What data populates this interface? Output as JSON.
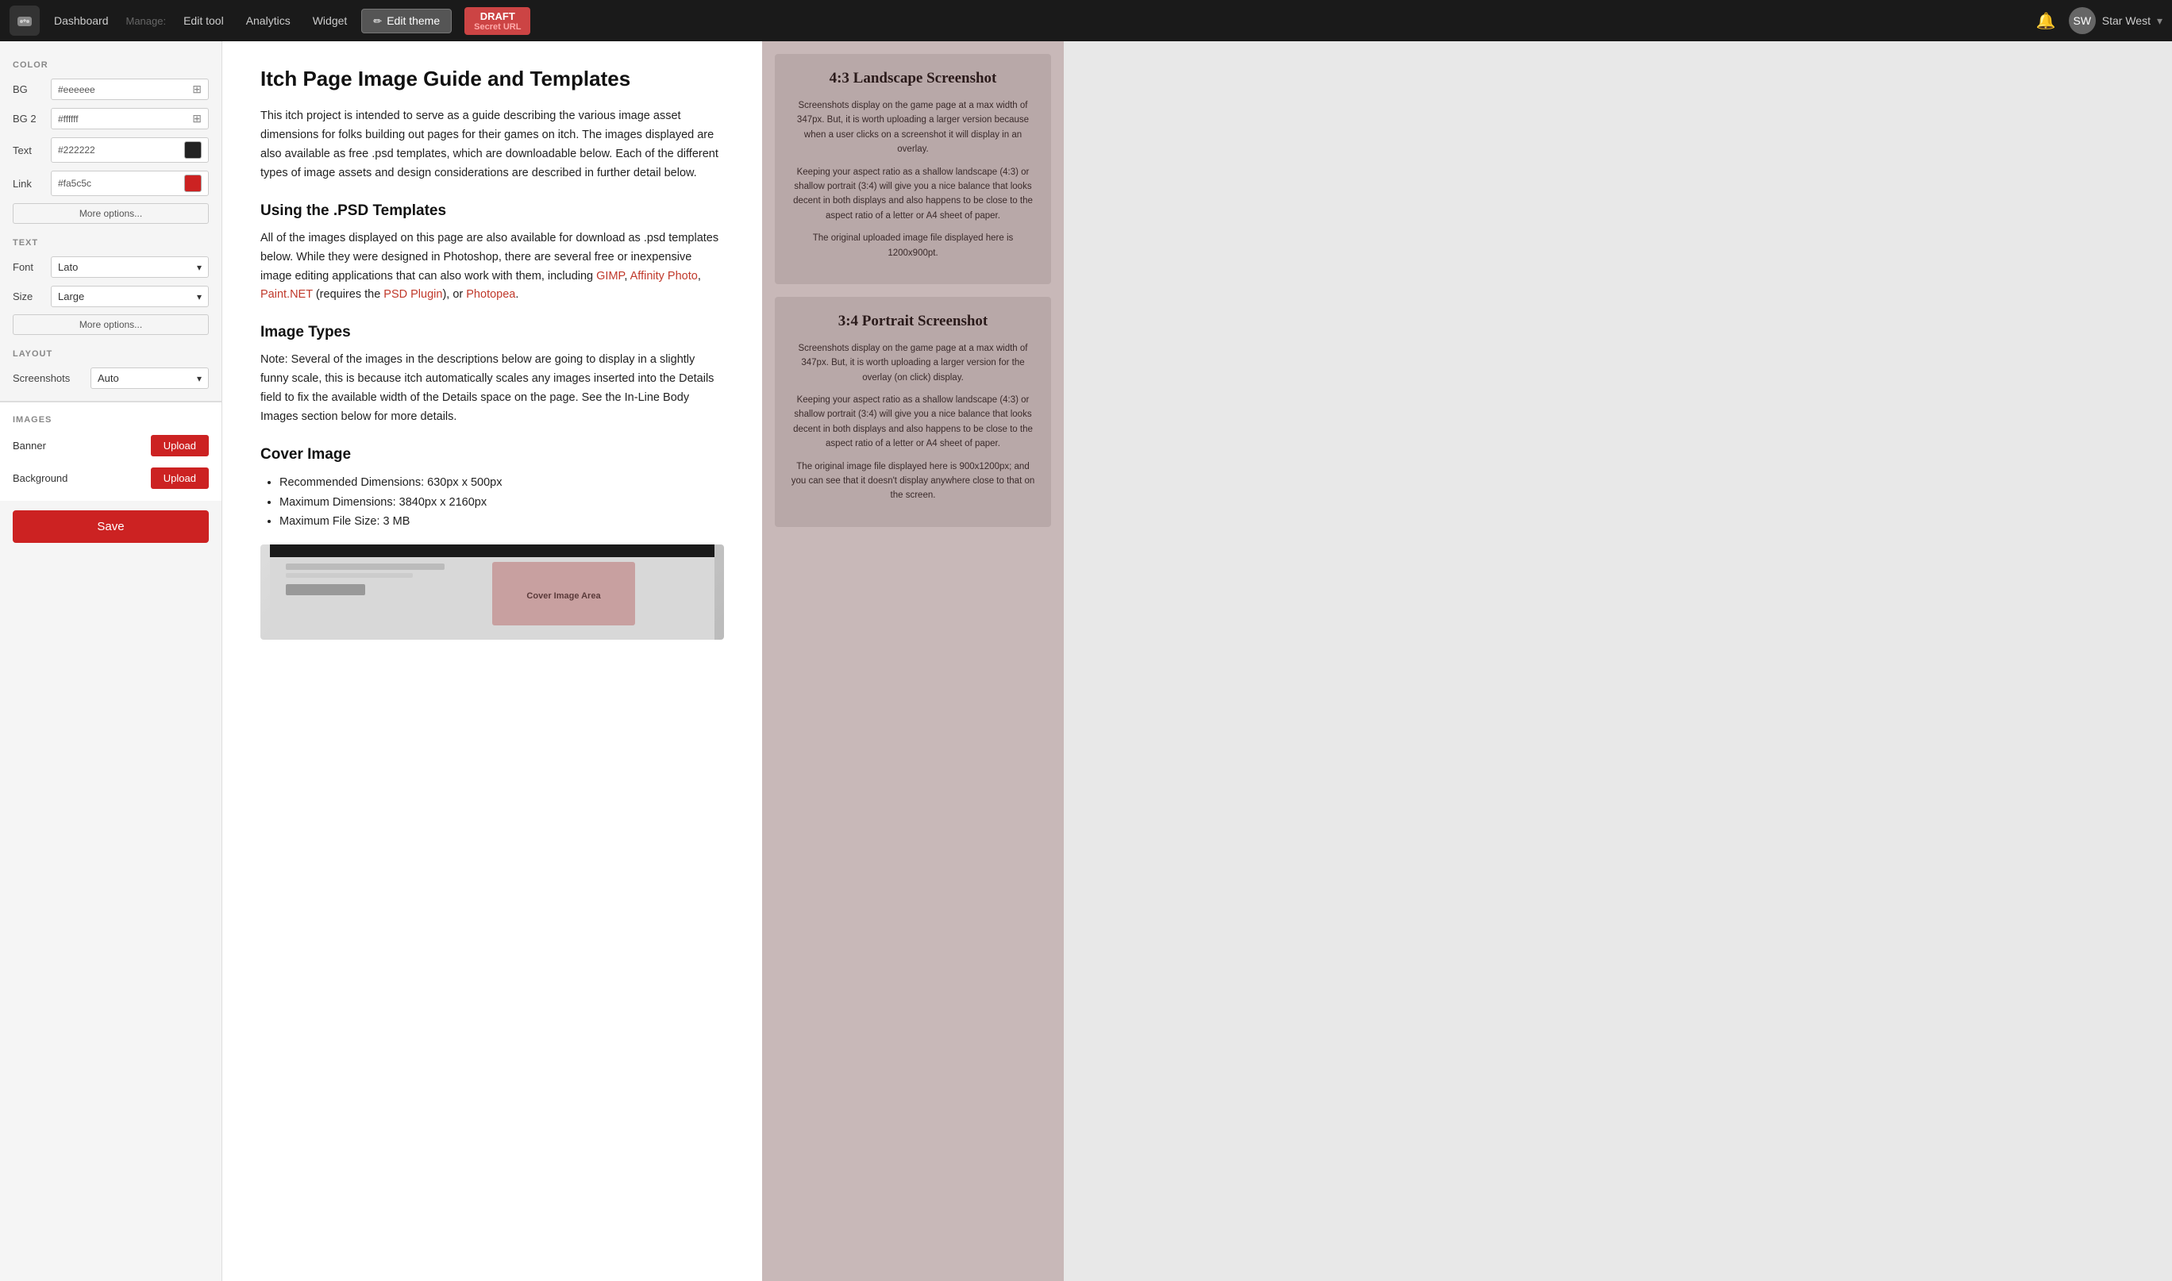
{
  "nav": {
    "logo_icon": "gamepad-icon",
    "dashboard_label": "Dashboard",
    "manage_label": "Manage:",
    "edit_tool_label": "Edit tool",
    "analytics_label": "Analytics",
    "widget_label": "Widget",
    "edit_theme_label": "Edit theme",
    "draft_label": "DRAFT",
    "secret_url_label": "Secret URL",
    "bell_icon": "bell-icon",
    "user_name": "Star West",
    "chevron_icon": "chevron-down-icon"
  },
  "sidebar": {
    "color_section_label": "COLOR",
    "bg_label": "BG",
    "bg_value": "#eeeeee",
    "bg2_label": "BG 2",
    "bg2_value": "#ffffff",
    "text_label": "Text",
    "text_value": "#222222",
    "text_swatch_color": "#222222",
    "link_label": "Link",
    "link_value": "#fa5c5c",
    "link_swatch_color": "#cc2222",
    "more_options_label": "More options...",
    "text_section_label": "TEXT",
    "font_label": "Font",
    "font_value": "Lato",
    "size_label": "Size",
    "size_value": "Large",
    "more_options_text_label": "More options...",
    "layout_section_label": "LAYOUT",
    "screenshots_label": "Screenshots",
    "screenshots_value": "Auto",
    "images_section_label": "IMAGES",
    "banner_label": "Banner",
    "upload_banner_label": "Upload",
    "background_label": "Background",
    "upload_background_label": "Upload",
    "save_label": "Save"
  },
  "content": {
    "title": "Itch Page Image Guide and Templates",
    "intro_p1": "This itch project is intended to serve as a guide describing the various image asset dimensions for folks building out pages for their games on itch. The images displayed are also available as free .psd templates, which are downloadable below. Each of the different types of image assets and design considerations are described in further detail below.",
    "using_psd_heading": "Using the .PSD Templates",
    "using_psd_p1": "All of the images displayed on this page are also available for download as .psd templates below. While they were designed in Photoshop, there are several free or inexpensive image editing applications that can also work with them, including ",
    "gimp_link": "GIMP",
    "comma1": ", ",
    "affinity_link": "Affinity Photo",
    "comma2": ", ",
    "paintnet_link": "Paint.NET",
    "requires_text": " (requires the ",
    "psd_plugin_link": "PSD Plugin",
    "close_paren": "), or ",
    "photopea_link": "Photopea",
    "period": ".",
    "image_types_heading": "Image Types",
    "image_types_p1": "Note: Several of the images in the descriptions below are going to display in a slightly funny scale, this is because itch automatically scales any images inserted into the Details field to fix the available width of the Details space on the page. See the In-Line Body Images section below for more details.",
    "cover_image_heading": "Cover Image",
    "cover_image_bullets": [
      "Recommended Dimensions: 630px x 500px",
      "Maximum Dimensions: 3840px x 2160px",
      "Maximum File Size: 3 MB"
    ]
  },
  "right_panel": {
    "card1_title": "4:3 Landscape Screenshot",
    "card1_p1": "Screenshots display on the game page at a max width of 347px. But, it is worth uploading a larger version because when a user clicks on a screenshot it will display in an overlay.",
    "card1_p2": "Keeping your aspect ratio as a shallow landscape (4:3) or shallow portrait (3:4) will give you a nice balance that looks decent in both displays and also happens to be close to the aspect ratio of a letter or A4 sheet of paper.",
    "card1_p3": "The original uploaded image file displayed here is 1200x900pt.",
    "card2_title": "3:4 Portrait Screenshot",
    "card2_p1": "Screenshots display on the game page at a max width of 347px. But, it is worth uploading a larger version for the overlay (on click) display.",
    "card2_p2": "Keeping your aspect ratio as a shallow landscape (4:3) or shallow portrait (3:4) will give you a nice balance that looks decent in both displays and also happens to be close to the aspect ratio of a letter or A4 sheet of paper.",
    "card2_p3": "The original image file displayed here is 900x1200px; and you can see that it doesn't display anywhere close to that on the screen."
  }
}
